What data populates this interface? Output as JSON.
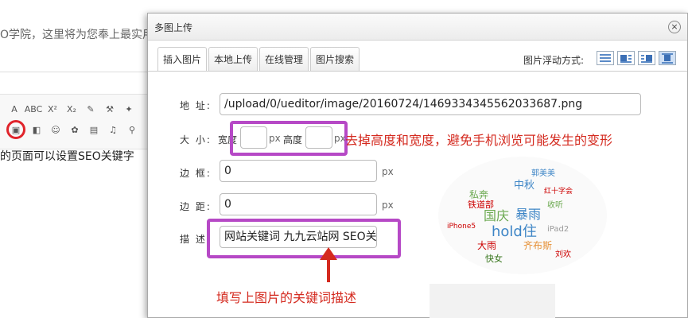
{
  "background": {
    "top_text": "O学院，这里将为您奉上最实用",
    "seo_text": "的页面可以设置SEO关键字"
  },
  "toolbar": {
    "row1": [
      "A",
      "ABC",
      "X²",
      "X₂",
      "✎",
      "⚒",
      "✦"
    ],
    "row2": [
      "▣",
      "◧",
      "☺",
      "✿",
      "▤",
      "♫",
      "⚲"
    ]
  },
  "dialog": {
    "title": "多图上传",
    "close_label": "×",
    "tabs": [
      "插入图片",
      "本地上传",
      "在线管理",
      "图片搜索"
    ],
    "float_label": "图片浮动方式:",
    "fields": {
      "address_label": "地 址:",
      "address_value": "/upload/0/ueditor/image/20160724/1469334345562033687.png",
      "size_label": "大 小:",
      "width_label": "宽度",
      "width_value": "",
      "px1": "px",
      "height_label": "高度",
      "height_value": "",
      "px2": "px",
      "border_label": "边 框:",
      "border_value": "0",
      "border_unit": "px",
      "margin_label": "边 距:",
      "margin_value": "0",
      "margin_unit": "px",
      "desc_label": "描 述:",
      "desc_value": "网站关键词 九九云站网 SEO关"
    }
  },
  "annotations": {
    "size_note": "去掉高度和宽度，避免手机浏览可能发生的变形",
    "desc_note": "填写上图片的关键词描述"
  },
  "preview": {
    "cloud_words": [
      "国庆",
      "hold住",
      "私奔",
      "暴雨",
      "铁道部",
      "大雨",
      "中秋",
      "齐布斯",
      "收听",
      "iPad2",
      "快女",
      "iPhone5",
      "刘欢",
      "郭美美",
      "红十字会"
    ]
  },
  "colors": {
    "highlight": "#b649c6",
    "annotation": "#d42a1f"
  }
}
